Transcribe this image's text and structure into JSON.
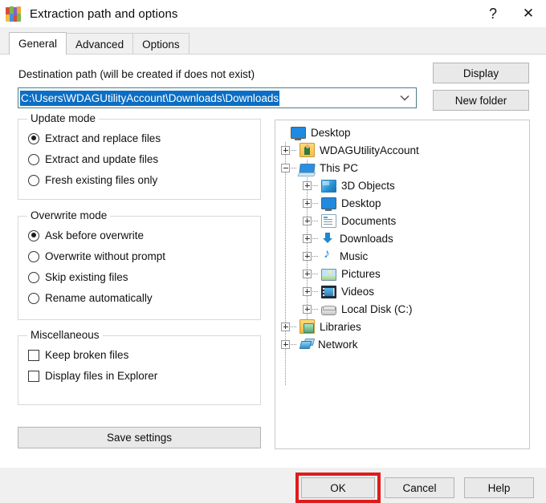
{
  "window": {
    "title": "Extraction path and options",
    "icon": "winrar-books-icon",
    "help_button": "?",
    "close_button": "✕"
  },
  "tabs": [
    {
      "label": "General",
      "active": true
    },
    {
      "label": "Advanced",
      "active": false
    },
    {
      "label": "Options",
      "active": false
    }
  ],
  "destination": {
    "label": "Destination path (will be created if does not exist)",
    "value": "C:\\Users\\WDAGUtilityAccount\\Downloads\\Downloads",
    "selected": true,
    "dropdown_icon": "chevron-down-icon"
  },
  "side_buttons": {
    "display": "Display",
    "new_folder": "New folder"
  },
  "groups": [
    {
      "id": "update_mode",
      "title": "Update mode",
      "type": "radio",
      "options": [
        {
          "label": "Extract and replace files",
          "checked": true
        },
        {
          "label": "Extract and update files",
          "checked": false
        },
        {
          "label": "Fresh existing files only",
          "checked": false
        }
      ]
    },
    {
      "id": "overwrite_mode",
      "title": "Overwrite mode",
      "type": "radio",
      "options": [
        {
          "label": "Ask before overwrite",
          "checked": true
        },
        {
          "label": "Overwrite without prompt",
          "checked": false
        },
        {
          "label": "Skip existing files",
          "checked": false
        },
        {
          "label": "Rename automatically",
          "checked": false
        }
      ]
    },
    {
      "id": "miscellaneous",
      "title": "Miscellaneous",
      "type": "checkbox",
      "options": [
        {
          "label": "Keep broken files",
          "checked": false
        },
        {
          "label": "Display files in Explorer",
          "checked": false
        }
      ]
    }
  ],
  "save_settings_button": "Save settings",
  "tree": [
    {
      "label": "Desktop",
      "depth": 0,
      "expander": "none",
      "icon": "monitor-icon"
    },
    {
      "label": "WDAGUtilityAccount",
      "depth": 1,
      "expander": "plus",
      "icon": "user-folder-icon"
    },
    {
      "label": "This PC",
      "depth": 1,
      "expander": "minus",
      "icon": "this-pc-icon"
    },
    {
      "label": "3D Objects",
      "depth": 2,
      "expander": "plus",
      "icon": "3d-objects-icon"
    },
    {
      "label": "Desktop",
      "depth": 2,
      "expander": "plus",
      "icon": "monitor-icon"
    },
    {
      "label": "Documents",
      "depth": 2,
      "expander": "plus",
      "icon": "documents-icon"
    },
    {
      "label": "Downloads",
      "depth": 2,
      "expander": "plus",
      "icon": "downloads-arrow-icon"
    },
    {
      "label": "Music",
      "depth": 2,
      "expander": "plus",
      "icon": "music-note-icon"
    },
    {
      "label": "Pictures",
      "depth": 2,
      "expander": "plus",
      "icon": "pictures-icon"
    },
    {
      "label": "Videos",
      "depth": 2,
      "expander": "plus",
      "icon": "videos-icon"
    },
    {
      "label": "Local Disk (C:)",
      "depth": 2,
      "expander": "plus",
      "icon": "local-disk-icon"
    },
    {
      "label": "Libraries",
      "depth": 1,
      "expander": "plus",
      "icon": "libraries-icon"
    },
    {
      "label": "Network",
      "depth": 1,
      "expander": "plus",
      "icon": "network-icon"
    }
  ],
  "footer_buttons": {
    "ok": "OK",
    "cancel": "Cancel",
    "help": "Help"
  },
  "annotation": {
    "type": "highlight-rectangle",
    "target": "ok-button",
    "color": "#e01b1b"
  }
}
